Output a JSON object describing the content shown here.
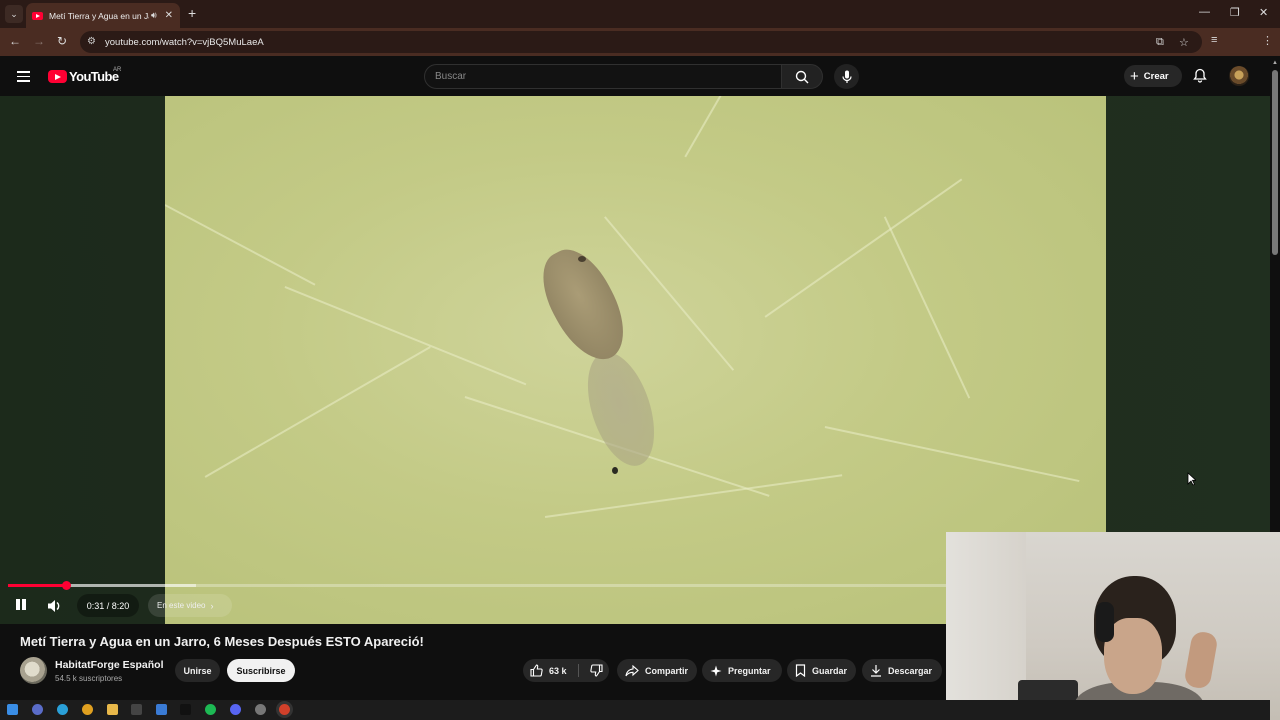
{
  "browser": {
    "tab_title": "Metí Tierra y Agua en un Jarro, 6 Meses Después ESTO Apareció!",
    "url": "youtube.com/watch?v=vjBQ5MuLaeA"
  },
  "header": {
    "logo_text": "YouTube",
    "country_code": "AR",
    "search_placeholder": "Buscar",
    "create_label": "Crear"
  },
  "player": {
    "time_display": "0:31 / 8:20",
    "chapter_label": "En este video",
    "progress_fraction": 0.062,
    "buffer_fraction": 0.2
  },
  "video": {
    "title": "Metí Tierra y Agua en un Jarro, 6 Meses Después ESTO Apareció!",
    "channel_name": "HabitatForge Español",
    "subscribers": "54.5 k suscriptores",
    "join_label": "Unirse",
    "subscribe_label": "Suscribirse",
    "likes": "63 k",
    "share_label": "Compartir",
    "ask_label": "Preguntar",
    "save_label": "Guardar",
    "download_label": "Descargar"
  },
  "colors": {
    "brand": "#ff0033",
    "background": "#0f0f0f",
    "chrome_frame": "#4a2c22"
  }
}
